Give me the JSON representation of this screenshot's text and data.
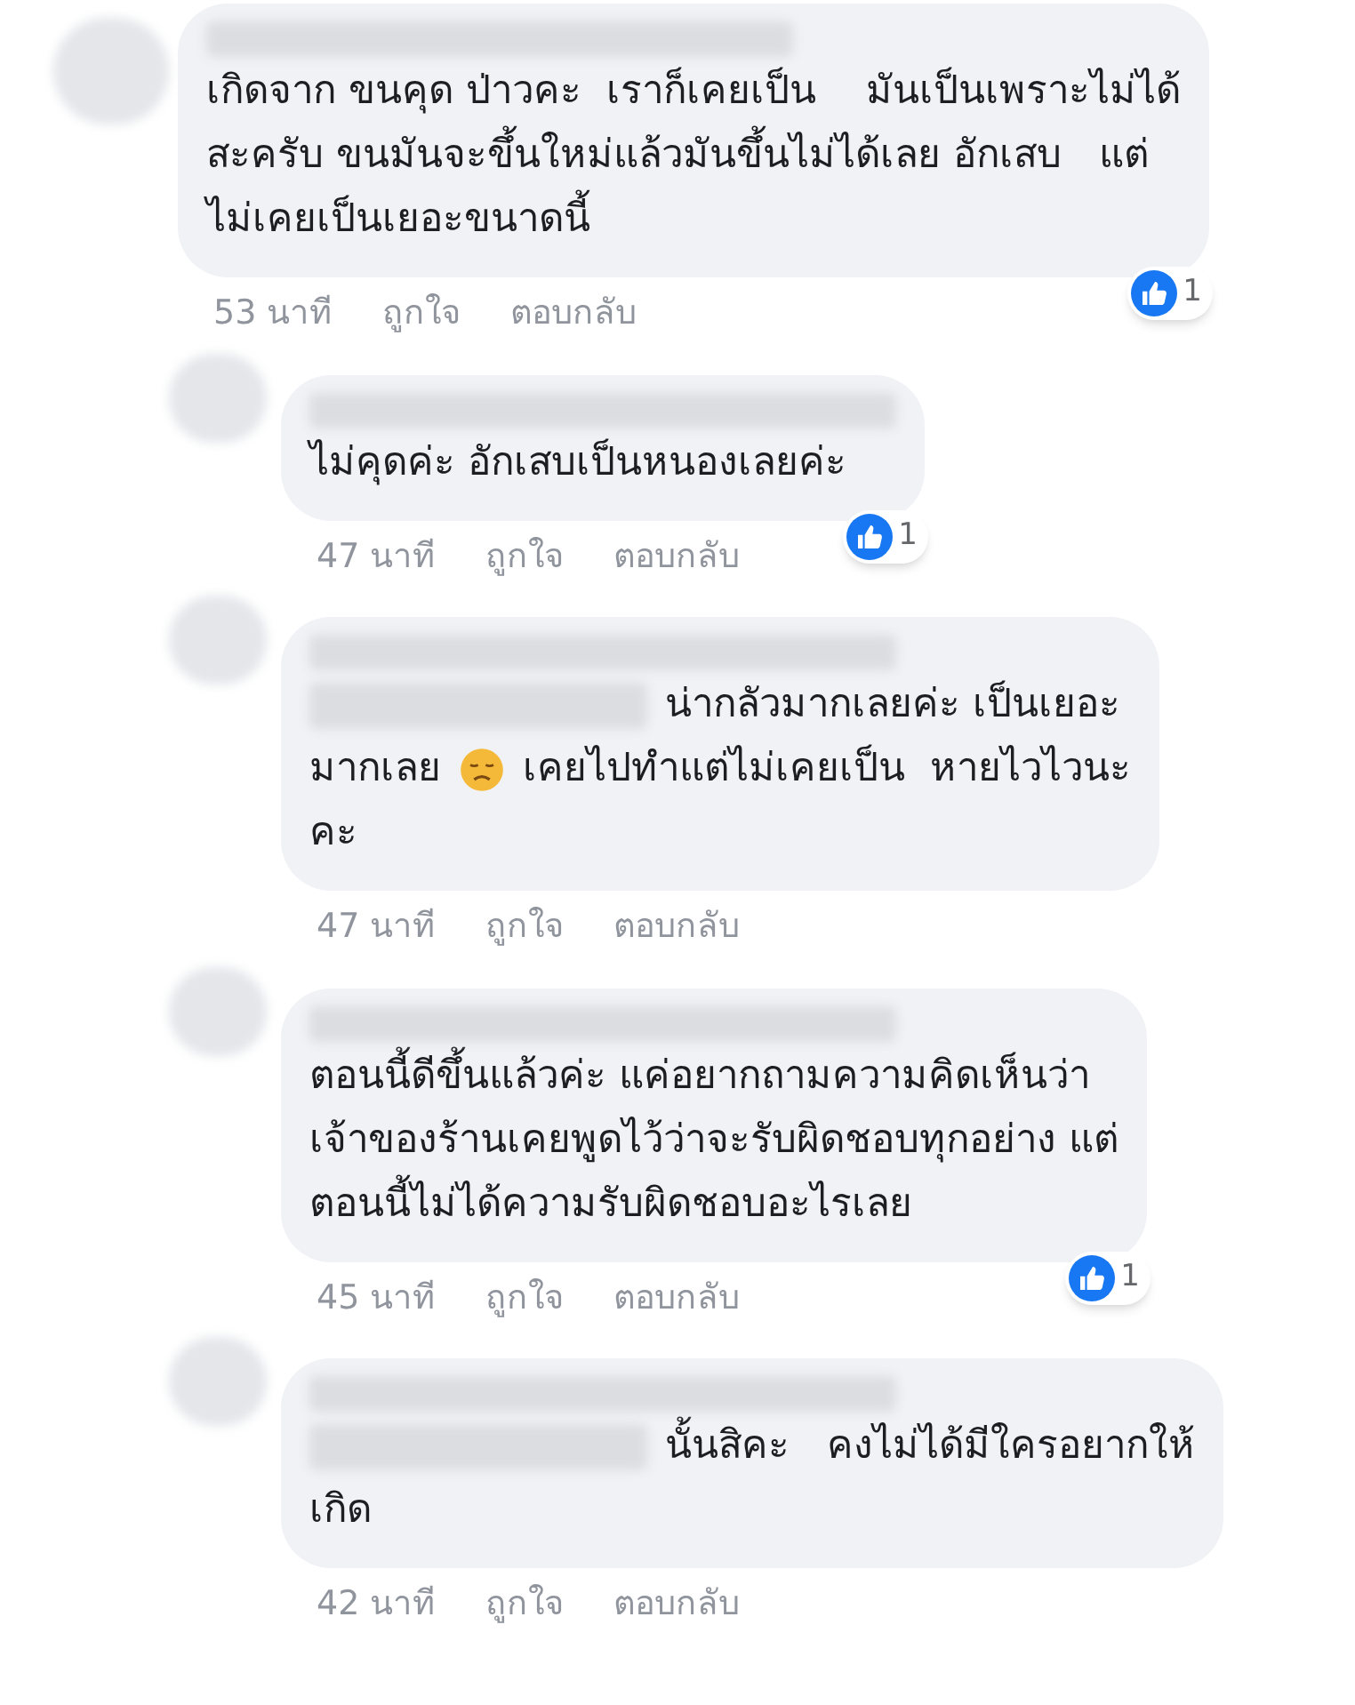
{
  "comments": [
    {
      "kind": "top",
      "lines": [
        [
          {
            "kind": "text",
            "text": "เกิดจาก ขนคุด ป่าวคะ  เราก็เคยเป็น    มันเป็นเพราะไม่ได้"
          }
        ],
        [
          {
            "kind": "text",
            "text": "สะครับ ขนมันจะขึ้นใหม่แล้วมันขึ้นไม่ได้เลย อักเสบ   แต่"
          }
        ],
        [
          {
            "kind": "text",
            "text": "ไม่เคยเป็นเยอะขนาดนี้"
          }
        ]
      ],
      "time": "53 นาที",
      "like": "ถูกใจ",
      "reply": "ตอบกลับ",
      "likes": "1"
    },
    {
      "kind": "reply",
      "lines": [
        [
          {
            "kind": "text",
            "text": "ไม่คุดค่ะ อักเสบเป็นหนองเลยค่ะ"
          }
        ]
      ],
      "time": "47 นาที",
      "like": "ถูกใจ",
      "reply": "ตอบกลับ",
      "likes": "1"
    },
    {
      "kind": "reply",
      "lines": [
        [
          {
            "kind": "redacted"
          },
          {
            "kind": "text",
            "text": "น่ากลัวมากเลยค่ะ เป็นเยอะ"
          }
        ],
        [
          {
            "kind": "text",
            "text": "มากเลย"
          },
          {
            "kind": "emoji"
          },
          {
            "kind": "text",
            "text": "เคยไปทำแต่ไม่เคยเป็น  หายไวไวนะ"
          }
        ],
        [
          {
            "kind": "text",
            "text": "คะ"
          }
        ]
      ],
      "time": "47 นาที",
      "like": "ถูกใจ",
      "reply": "ตอบกลับ"
    },
    {
      "kind": "reply",
      "lines": [
        [
          {
            "kind": "text",
            "text": "ตอนนี้ดีขึ้นแล้วค่ะ แค่อยากถามความคิดเห็นว่า"
          }
        ],
        [
          {
            "kind": "text",
            "text": "เจ้าของร้านเคยพูดไว้ว่าจะรับผิดชอบทุกอย่าง แต่"
          }
        ],
        [
          {
            "kind": "text",
            "text": "ตอนนี้ไม่ได้ความรับผิดชอบอะไรเลย"
          }
        ]
      ],
      "time": "45 นาที",
      "like": "ถูกใจ",
      "reply": "ตอบกลับ",
      "likes": "1"
    },
    {
      "kind": "reply",
      "lines": [
        [
          {
            "kind": "redacted"
          },
          {
            "kind": "text",
            "text": "นั้นสิคะ   คงไม่ได้มีใครอยากให้"
          }
        ],
        [
          {
            "kind": "text",
            "text": "เกิด"
          }
        ]
      ],
      "time": "42 นาที",
      "like": "ถูกใจ",
      "reply": "ตอบกลับ"
    }
  ]
}
